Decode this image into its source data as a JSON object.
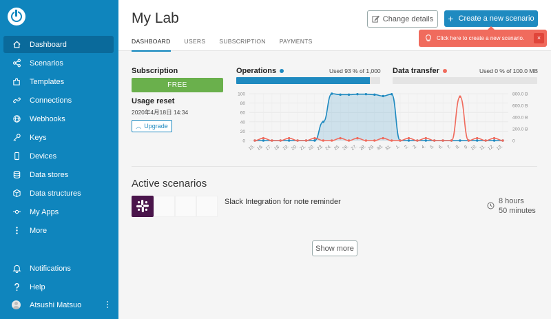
{
  "sidebar": {
    "items": [
      {
        "label": "Dashboard",
        "icon": "home-icon"
      },
      {
        "label": "Scenarios",
        "icon": "share-icon"
      },
      {
        "label": "Templates",
        "icon": "puzzle-icon"
      },
      {
        "label": "Connections",
        "icon": "link-icon"
      },
      {
        "label": "Webhooks",
        "icon": "globe-icon"
      },
      {
        "label": "Keys",
        "icon": "key-icon"
      },
      {
        "label": "Devices",
        "icon": "phone-icon"
      },
      {
        "label": "Data stores",
        "icon": "database-icon"
      },
      {
        "label": "Data structures",
        "icon": "cube-icon"
      },
      {
        "label": "My Apps",
        "icon": "node-icon"
      },
      {
        "label": "More",
        "icon": "more-vertical-icon"
      }
    ],
    "bottom": [
      {
        "label": "Notifications",
        "icon": "bell-icon"
      },
      {
        "label": "Help",
        "icon": "question-icon"
      }
    ],
    "user_name": "Atsushi Matsuo"
  },
  "header": {
    "title": "My Lab",
    "tabs": [
      "DASHBOARD",
      "USERS",
      "SUBSCRIPTION",
      "PAYMENTS"
    ],
    "change_details": "Change details",
    "create_button": "Create a new scenario",
    "tooltip": "Click here to create a new scenario.",
    "tooltip_close": "×"
  },
  "subscription": {
    "title": "Subscription",
    "plan": "FREE",
    "usage_reset_title": "Usage reset",
    "usage_reset_date": "2020年4月18日 14:34",
    "upgrade": "Upgrade"
  },
  "operations": {
    "title": "Operations",
    "used_text": "Used 93 % of 1,000",
    "used_fraction": 0.93,
    "color": "#1f8ac0"
  },
  "data_transfer": {
    "title": "Data transfer",
    "used_text": "Used 0 % of 100.0 MB",
    "used_fraction": 0.0,
    "color": "#f06b5d"
  },
  "chart_data": {
    "type": "line",
    "categories": [
      "15.",
      "16.",
      "17.",
      "18.",
      "19.",
      "20.",
      "21.",
      "22.",
      "23.",
      "24.",
      "25.",
      "26.",
      "27.",
      "28.",
      "29.",
      "30.",
      "31.",
      "1.",
      "2.",
      "3.",
      "4.",
      "5.",
      "6.",
      "7.",
      "8.",
      "9.",
      "10.",
      "11.",
      "12.",
      "13."
    ],
    "series": [
      {
        "name": "Operations",
        "axis": "left",
        "color": "#1f8ac0",
        "values": [
          0,
          0,
          0,
          0,
          0,
          0,
          0,
          0,
          40,
          100,
          98,
          98,
          99,
          99,
          98,
          95,
          99,
          0,
          0,
          0,
          0,
          0,
          0,
          0,
          0,
          0,
          0,
          0,
          0,
          0
        ]
      },
      {
        "name": "Data transfer",
        "axis": "right",
        "color": "#f06b5d",
        "values": [
          0,
          40,
          0,
          0,
          40,
          0,
          0,
          40,
          0,
          0,
          40,
          0,
          40,
          0,
          0,
          40,
          0,
          0,
          40,
          0,
          40,
          0,
          0,
          0,
          750,
          0,
          40,
          0,
          40,
          0
        ]
      }
    ],
    "left_ticks": [
      "0",
      "20",
      "40",
      "60",
      "80",
      "100"
    ],
    "right_ticks": [
      "0",
      "200.0 B",
      "400.0 B",
      "600.0 B",
      "800.0 B"
    ],
    "ylim_left": [
      0,
      100
    ],
    "ylim_right": [
      0,
      800
    ],
    "grid": true
  },
  "active": {
    "title": "Active scenarios",
    "scenario_name": "Slack Integration for note reminder",
    "schedule_line1": "8 hours",
    "schedule_line2": "50 minutes",
    "show_more": "Show more"
  }
}
